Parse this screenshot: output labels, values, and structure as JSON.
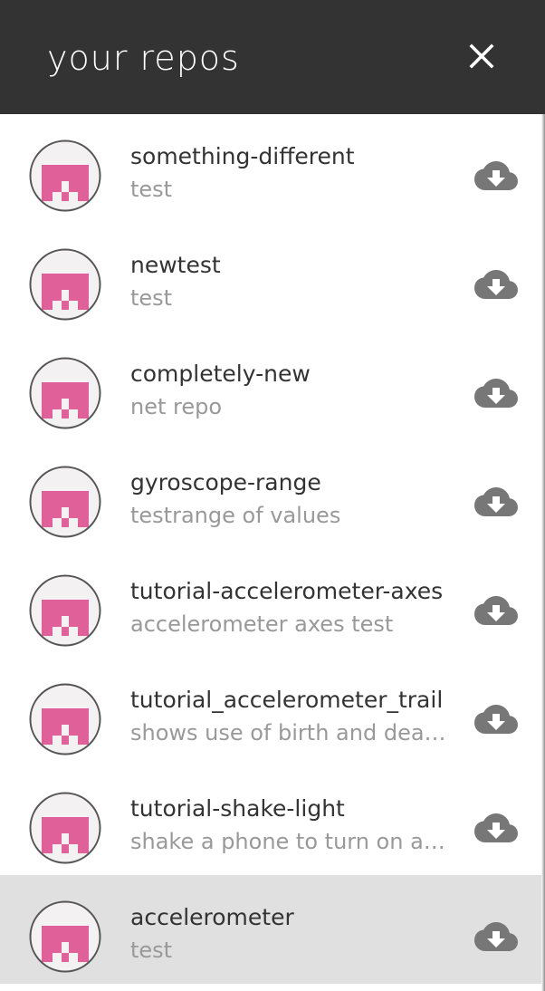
{
  "header": {
    "title": "your repos",
    "close_icon": "close-icon",
    "background": "#333333"
  },
  "colors": {
    "avatar_pink": "#e0609a",
    "avatar_light": "#f3f1f1",
    "selected_row": "#e0e0e0",
    "icon_gray": "#777777",
    "name_text": "#333333",
    "desc_text": "#999999"
  },
  "repos": [
    {
      "name": "something-different",
      "description": "test",
      "icon": "cloud-download-icon",
      "selected": false
    },
    {
      "name": "newtest",
      "description": "test",
      "icon": "cloud-download-icon",
      "selected": false
    },
    {
      "name": "completely-new",
      "description": "net repo",
      "icon": "cloud-download-icon",
      "selected": false
    },
    {
      "name": "gyroscope-range",
      "description": "testrange of values",
      "icon": "cloud-download-icon",
      "selected": false
    },
    {
      "name": "tutorial-accelerometer-axes",
      "description": "accelerometer axes test",
      "icon": "cloud-download-icon",
      "selected": false
    },
    {
      "name": "tutorial_accelerometer_trail",
      "description": "shows use of birth and death…",
      "icon": "cloud-download-icon",
      "selected": false
    },
    {
      "name": "tutorial-shake-light",
      "description": "shake a phone to turn on a li…",
      "icon": "cloud-download-icon",
      "selected": false
    },
    {
      "name": "accelerometer",
      "description": "test",
      "icon": "cloud-download-icon",
      "selected": true
    }
  ]
}
